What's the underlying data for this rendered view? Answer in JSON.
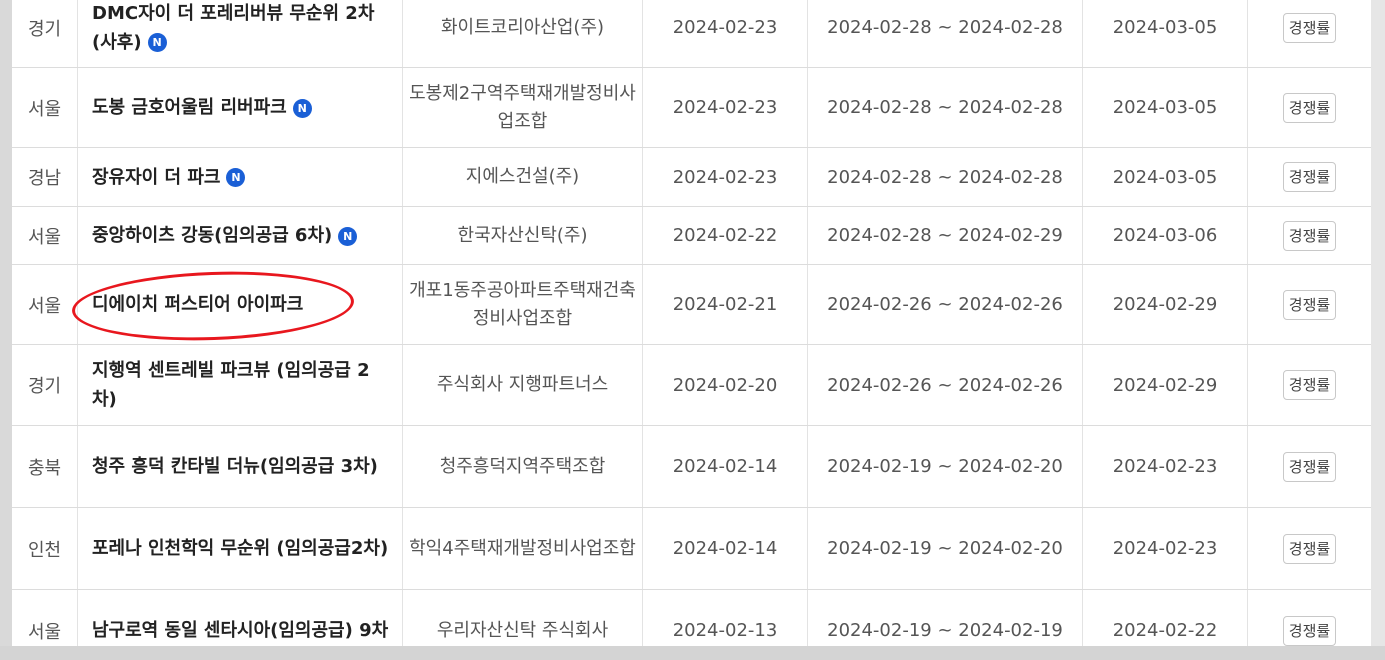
{
  "table": {
    "button_label": "경쟁률",
    "new_badge": "N",
    "rows": [
      {
        "region": "경기",
        "name": "DMC자이 더 포레리버뷰 무순위 2차 (사후)",
        "is_new": true,
        "builder": "화이트코리아산업(주)",
        "announce_date": "2024-02-23",
        "period": "2024-02-28 ~ 2024-02-28",
        "winner_date": "2024-03-05"
      },
      {
        "region": "서울",
        "name": "도봉 금호어울림 리버파크",
        "is_new": true,
        "builder": "도봉제2구역주택재개발정비사업조합",
        "announce_date": "2024-02-23",
        "period": "2024-02-28 ~ 2024-02-28",
        "winner_date": "2024-03-05"
      },
      {
        "region": "경남",
        "name": "장유자이 더 파크",
        "is_new": true,
        "builder": "지에스건설(주)",
        "announce_date": "2024-02-23",
        "period": "2024-02-28 ~ 2024-02-28",
        "winner_date": "2024-03-05"
      },
      {
        "region": "서울",
        "name": "중앙하이츠 강동(임의공급 6차)",
        "is_new": true,
        "builder": "한국자산신탁(주)",
        "announce_date": "2024-02-22",
        "period": "2024-02-28 ~ 2024-02-29",
        "winner_date": "2024-03-06"
      },
      {
        "region": "서울",
        "name": "디에이치 퍼스티어 아이파크",
        "is_new": false,
        "builder": "개포1동주공아파트주택재건축정비사업조합",
        "announce_date": "2024-02-21",
        "period": "2024-02-26 ~ 2024-02-26",
        "winner_date": "2024-02-29"
      },
      {
        "region": "경기",
        "name": "지행역 센트레빌 파크뷰 (임의공급 2차)",
        "is_new": false,
        "builder": "주식회사 지행파트너스",
        "announce_date": "2024-02-20",
        "period": "2024-02-26 ~ 2024-02-26",
        "winner_date": "2024-02-29"
      },
      {
        "region": "충북",
        "name": "청주 흥덕 칸타빌 더뉴(임의공급 3차)",
        "is_new": false,
        "builder": "청주흥덕지역주택조합",
        "announce_date": "2024-02-14",
        "period": "2024-02-19 ~ 2024-02-20",
        "winner_date": "2024-02-23"
      },
      {
        "region": "인천",
        "name": "포레나 인천학익 무순위 (임의공급2차)",
        "is_new": false,
        "builder": "학익4주택재개발정비사업조합",
        "announce_date": "2024-02-14",
        "period": "2024-02-19 ~ 2024-02-20",
        "winner_date": "2024-02-23"
      },
      {
        "region": "서울",
        "name": "남구로역 동일 센타시아(임의공급) 9차",
        "is_new": false,
        "builder": "우리자산신탁 주식회사",
        "announce_date": "2024-02-13",
        "period": "2024-02-19 ~ 2024-02-19",
        "winner_date": "2024-02-22"
      }
    ]
  }
}
